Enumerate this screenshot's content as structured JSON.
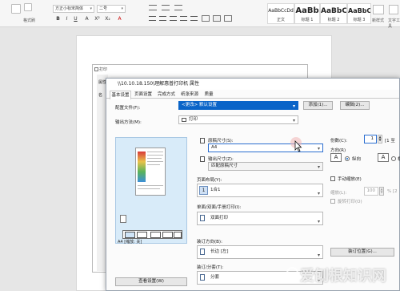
{
  "ribbon": {
    "font_name": "方正小标宋简体",
    "font_size": "二号",
    "format_painter": "格式刷",
    "font_buttons": [
      "B",
      "I",
      "U",
      "A",
      "X²",
      "X₂",
      "A"
    ],
    "styles": [
      {
        "sample": "AaBbCcDd",
        "name": "正文"
      },
      {
        "sample": "AaBb",
        "name": "标题 1"
      },
      {
        "sample": "AaBbC",
        "name": "标题 2"
      },
      {
        "sample": "AaBbC",
        "name": "标题 3"
      }
    ],
    "new_style": "新样式",
    "text_tool": "文字工具"
  },
  "old_dialog": {
    "title": "打印",
    "left_label": "属性",
    "partial_label": "名"
  },
  "dialog": {
    "title": "\\\\10.10.18.150\\理解惠普打印机 属性",
    "tabs": [
      "基本设置",
      "页面设置",
      "完成方式",
      "纸张来源",
      "质量"
    ],
    "profile_label": "配置文件(F):",
    "profile_value": "<更改> 默认设置",
    "add_button": "添加(1)...",
    "edit_button": "编辑(2)...",
    "output_label": "输出方法(M):",
    "output_value": "打印",
    "paper_size_label": "原稿尺寸(S):",
    "paper_size_value": "A4",
    "output_size_label": "输出尺寸(Z):",
    "output_size_value": "匹配原稿尺寸",
    "layout_label": "页面布局(Y):",
    "layout_value": "1合1",
    "duplex_label": "单面/双面/手册打印(I):",
    "duplex_value": "双面打印",
    "binding_label": "装订方向(B):",
    "binding_value": "长边 [左]",
    "binding_button": "装订位置(G)...",
    "staple_label": "装订/分套(T):",
    "staple_value": "分套",
    "copies_label": "份数(C):",
    "copies_value": "1",
    "copies_range": "[1 至",
    "orientation_label": "方向(R)",
    "portrait_label": "纵向",
    "landscape_label": "横",
    "manual_scale_label": "手动缩放(E)",
    "scale_label": "缩放(L):",
    "scale_value": "100",
    "scale_range": "% [2",
    "reverse_label": "旋转打印(O)",
    "preview_caption": "A4 [缩放: 关]",
    "view_settings_button": "查看设置(W)"
  },
  "watermark": "爱刨根知识网",
  "colors": {
    "accent": "#0a64c8",
    "preview_bg": "#d8ebf9",
    "ribbon_bg": "#f6f6f6"
  }
}
